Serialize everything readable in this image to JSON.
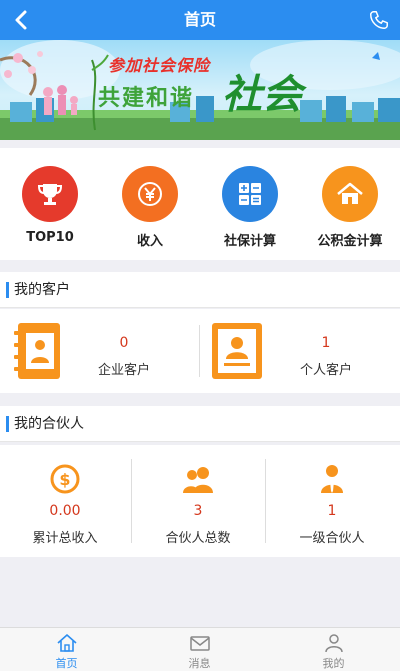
{
  "header": {
    "title": "首页"
  },
  "banner": {
    "line1": "参加社会保险",
    "line2": "共建和谐",
    "line3": "社会"
  },
  "quick_actions": [
    {
      "label": "TOP10",
      "icon": "trophy-icon",
      "color": "#e53a2c"
    },
    {
      "label": "收入",
      "icon": "yen-icon",
      "color": "#f36f21"
    },
    {
      "label": "社保计算",
      "icon": "calculator-icon",
      "color": "#2a84e0"
    },
    {
      "label": "公积金计算",
      "icon": "house-icon",
      "color": "#f7941d"
    }
  ],
  "my_clients": {
    "title": "我的客户",
    "items": [
      {
        "value": "0",
        "label": "企业客户",
        "icon": "address-book-icon"
      },
      {
        "value": "1",
        "label": "个人客户",
        "icon": "id-card-icon"
      }
    ]
  },
  "my_partners": {
    "title": "我的合伙人",
    "items": [
      {
        "value": "0.00",
        "label": "累计总收入",
        "icon": "dollar-coin-icon"
      },
      {
        "value": "3",
        "label": "合伙人总数",
        "icon": "users-icon"
      },
      {
        "value": "1",
        "label": "一级合伙人",
        "icon": "person-tie-icon"
      }
    ]
  },
  "tabs": [
    {
      "label": "首页",
      "icon": "home-icon",
      "active": true
    },
    {
      "label": "消息",
      "icon": "envelope-icon",
      "active": false
    },
    {
      "label": "我的",
      "icon": "user-icon",
      "active": false
    }
  ],
  "colors": {
    "primary": "#2b8df0",
    "value_red": "#d4371c",
    "orange": "#f7941d"
  }
}
